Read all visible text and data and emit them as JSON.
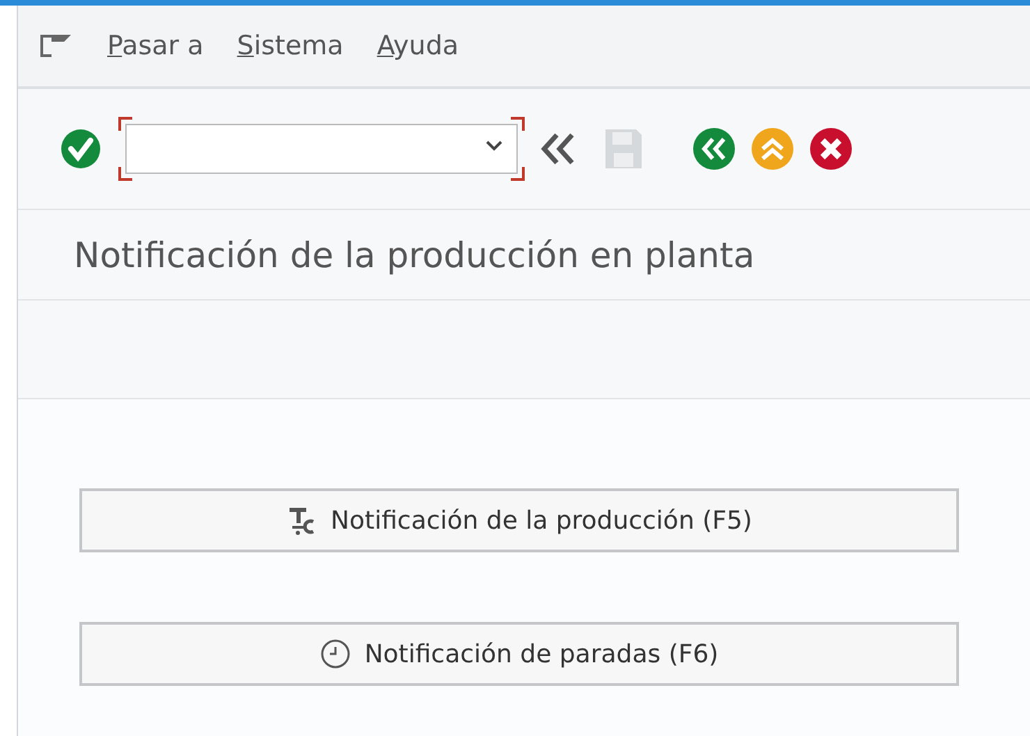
{
  "menu": {
    "items": [
      {
        "label": "Pasar a"
      },
      {
        "label": "Sistema"
      },
      {
        "label": "Ayuda"
      }
    ]
  },
  "toolbar": {
    "command_field": {
      "focused": true
    },
    "save": {
      "disabled": true
    }
  },
  "title": "Notificación de la producción en planta",
  "buttons": [
    {
      "kind": "production",
      "label": "Notificación de la producción (F5)"
    },
    {
      "kind": "clock",
      "label": "Notificación de paradas (F6)"
    }
  ]
}
